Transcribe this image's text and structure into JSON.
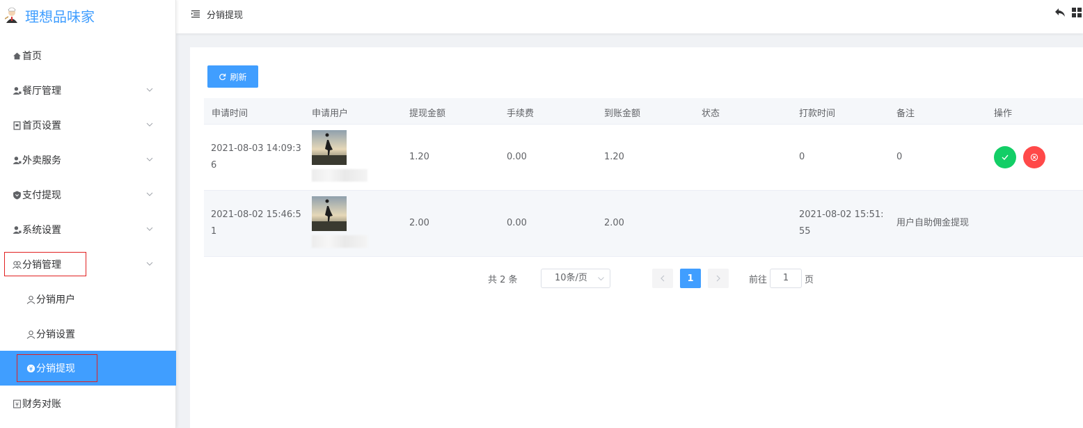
{
  "app": {
    "name": "理想品味家"
  },
  "sidebar": {
    "items": [
      {
        "label": "首页",
        "icon": "home-icon"
      },
      {
        "label": "餐厅管理",
        "icon": "user-icon"
      },
      {
        "label": "首页设置",
        "icon": "document-icon"
      },
      {
        "label": "外卖服务",
        "icon": "user-icon"
      },
      {
        "label": "支付提现",
        "icon": "shield-icon"
      },
      {
        "label": "系统设置",
        "icon": "user-icon"
      },
      {
        "label": "分销管理",
        "icon": "users-icon"
      },
      {
        "label": "分销用户",
        "icon": "user-outline-icon"
      },
      {
        "label": "分销设置",
        "icon": "user-outline-icon"
      },
      {
        "label": "分销提现",
        "icon": "coin-icon"
      },
      {
        "label": "财务对账",
        "icon": "ledger-icon"
      }
    ]
  },
  "header": {
    "title": "分销提现"
  },
  "toolbar": {
    "refresh_label": "刷新"
  },
  "table": {
    "columns": [
      "申请时间",
      "申请用户",
      "提现金额",
      "手续费",
      "到账金额",
      "状态",
      "打款时间",
      "备注",
      "操作"
    ],
    "rows": [
      {
        "apply_time_1": "2021-08-03 14:09:3",
        "apply_time_2": "6",
        "amount": "1.20",
        "fee": "0.00",
        "received": "1.20",
        "status": "",
        "pay_time_1": "0",
        "pay_time_2": "",
        "remark": "0"
      },
      {
        "apply_time_1": "2021-08-02 15:46:5",
        "apply_time_2": "1",
        "amount": "2.00",
        "fee": "0.00",
        "received": "2.00",
        "status": "",
        "pay_time_1": "2021-08-02 15:51:",
        "pay_time_2": "55",
        "remark": "用户自助佣金提现"
      }
    ]
  },
  "pagination": {
    "total_label": "共 2 条",
    "page_size_label": "10条/页",
    "current_page": "1",
    "goto_label": "前往",
    "goto_value": "1",
    "page_suffix": "页"
  },
  "colors": {
    "primary": "#409eff",
    "success": "#13ce66",
    "danger": "#ff4949",
    "highlight_box": "#e02020"
  }
}
